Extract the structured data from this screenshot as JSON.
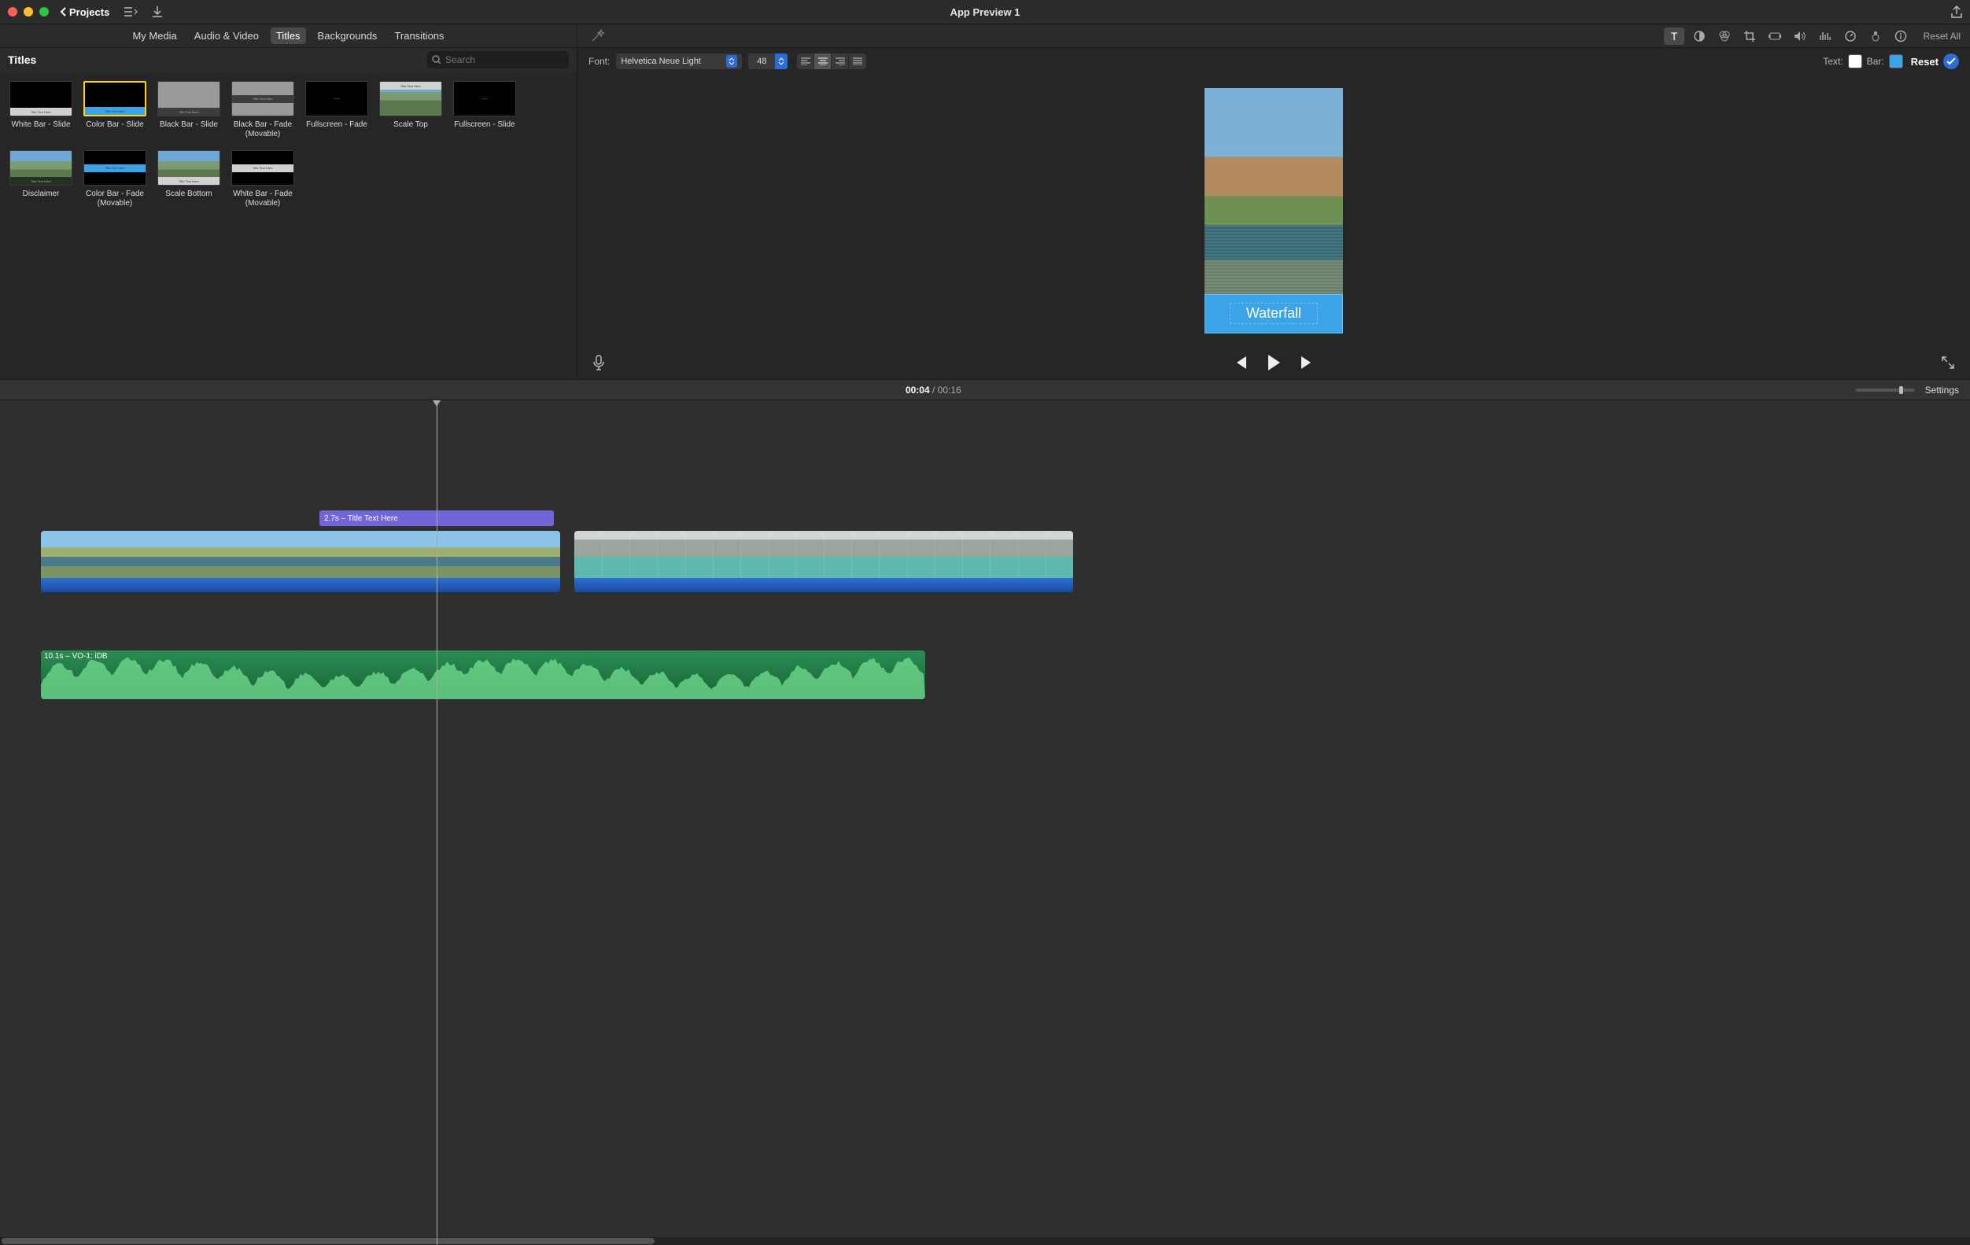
{
  "titlebar": {
    "back_label": "Projects",
    "window_title": "App Preview 1"
  },
  "library": {
    "tabs": [
      "My Media",
      "Audio & Video",
      "Titles",
      "Backgrounds",
      "Transitions"
    ],
    "active_tab": "Titles",
    "header_label": "Titles",
    "search_placeholder": "Search",
    "titles": [
      {
        "label": "White Bar - Slide",
        "kind": "white-bottom"
      },
      {
        "label": "Color Bar - Slide",
        "kind": "blue-bottom",
        "selected": true
      },
      {
        "label": "Black Bar - Slide",
        "kind": "grey-black-bottom"
      },
      {
        "label": "Black Bar - Fade (Movable)",
        "kind": "grey-black-mid"
      },
      {
        "label": "Fullscreen - Fade",
        "kind": "black-dash"
      },
      {
        "label": "Scale Top",
        "kind": "landscape-white-top"
      },
      {
        "label": "Fullscreen - Slide",
        "kind": "black-dash"
      },
      {
        "label": "Disclaimer",
        "kind": "landscape-black-bottom"
      },
      {
        "label": "Color Bar - Fade (Movable)",
        "kind": "blue-mid"
      },
      {
        "label": "Scale Bottom",
        "kind": "landscape-white-bottom"
      },
      {
        "label": "White Bar - Fade (Movable)",
        "kind": "white-mid"
      }
    ]
  },
  "inspector": {
    "reset_all_label": "Reset All",
    "font_label": "Font:",
    "font_value": "Helvetica Neue Light",
    "size_value": "48",
    "text_label": "Text:",
    "bar_label": "Bar:",
    "reset_label": "Reset",
    "text_color": "#ffffff",
    "bar_color": "#3ba3e8"
  },
  "viewer": {
    "title_text": "Waterfall"
  },
  "timeline": {
    "current_time": "00:04",
    "total_time": "00:16",
    "settings_label": "Settings",
    "title_clip_label": "2.7s – Title Text Here",
    "audio_clip_label": "10.1s – VO-1: iDB",
    "zoom_pos_pct": 78
  }
}
